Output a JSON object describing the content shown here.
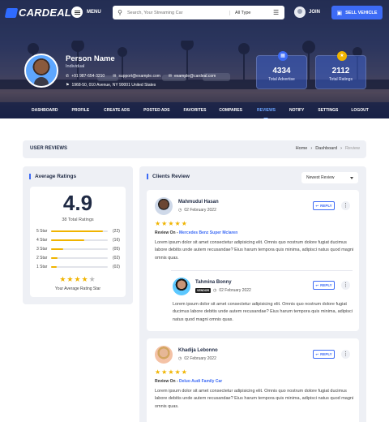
{
  "header": {
    "logo_text": "CARDEAL",
    "menu_label": "MENU",
    "search_placeholder": "Search, Your Streaming Car",
    "search_type": "All Type",
    "join_label": "JOIN",
    "sell_label": "SELL VEHICLE"
  },
  "profile": {
    "name": "Person Name",
    "role": "Individual",
    "phone": "+91 987-654-3210",
    "email1": "support@example.com",
    "email2": "example@cardeal.com",
    "address": "1968-50, 010 Avenue, NY 90001 United States"
  },
  "stats": [
    {
      "value": "4334",
      "label": "Total Advertise",
      "icon": "calendar-icon"
    },
    {
      "value": "2112",
      "label": "Total Ratings",
      "icon": "star-icon"
    }
  ],
  "nav": [
    "DASHBOARD",
    "PROFILE",
    "CREATE ADS",
    "POSTED ADS",
    "FAVORITES",
    "COMPARES",
    "REVIEWS",
    "NOTIFY",
    "SETTINGS",
    "LOGOUT"
  ],
  "page": {
    "title": "USER REVIEWS",
    "crumb_home": "Home",
    "crumb_sep": "›",
    "crumb_dash": "Dashboard",
    "crumb_current": "Review"
  },
  "ratings": {
    "title": "Average Ratings",
    "average": "4.9",
    "total": "38 Total Ratings",
    "rows": [
      {
        "label": "5 Star",
        "count": "(22)",
        "fill": 0.92
      },
      {
        "label": "4 Star",
        "count": "(16)",
        "fill": 0.58
      },
      {
        "label": "3 Star",
        "count": "(05)",
        "fill": 0.22
      },
      {
        "label": "2 Star",
        "count": "(02)",
        "fill": 0.12
      },
      {
        "label": "1 Star",
        "count": "(02)",
        "fill": 0.1
      }
    ],
    "stars_filled": "★★★★",
    "stars_empty": "★",
    "caption": "Your Average Rating Star"
  },
  "reviews": {
    "title": "Clients Review",
    "sort": "Newest Review",
    "reply_label": "REPLY",
    "review_on_label": "Review On -",
    "items": [
      {
        "name": "Mahmudul Hasan",
        "date": "02 February 2022",
        "stars": "★★★★★",
        "car": "Mercedes Benz Super Mclaren",
        "text": "Lorem ipsum dolor sit amet consectetur adipisicing elit. Omnis quo nostrum dolore fugiat ducimus labore debitis unde autem recusandae? Eius harum tempora quis minima, adipisci natus quod magni omnis quas."
      },
      {
        "name": "Tahmina Bonny",
        "tag": "VENDOR",
        "date": "02 February 2022",
        "text": "Lorem ipsum dolor sit amet consectetur adipisicing elit. Omnis quo nostrum dolore fugiat ducimus labore debitis unde autem recusandae? Eius harum tempora quis minima, adipisci natus quod magni omnis quas."
      },
      {
        "name": "Khadija Lebonno",
        "date": "02 February 2022",
        "stars": "★★★★★",
        "car": "Deluo Audi Family Car",
        "text": "Lorem ipsum dolor sit amet consectetur adipisicing elit. Omnis quo nostrum dolore fugiat ducimus labore debitis unde autem recusandae? Eius harum tempora quis minima, adipisci natus quod magni omnis quas."
      }
    ]
  },
  "colors": {
    "accent": "#3d6bf5",
    "star": "#f0b400",
    "panel": "#eef0f5"
  }
}
